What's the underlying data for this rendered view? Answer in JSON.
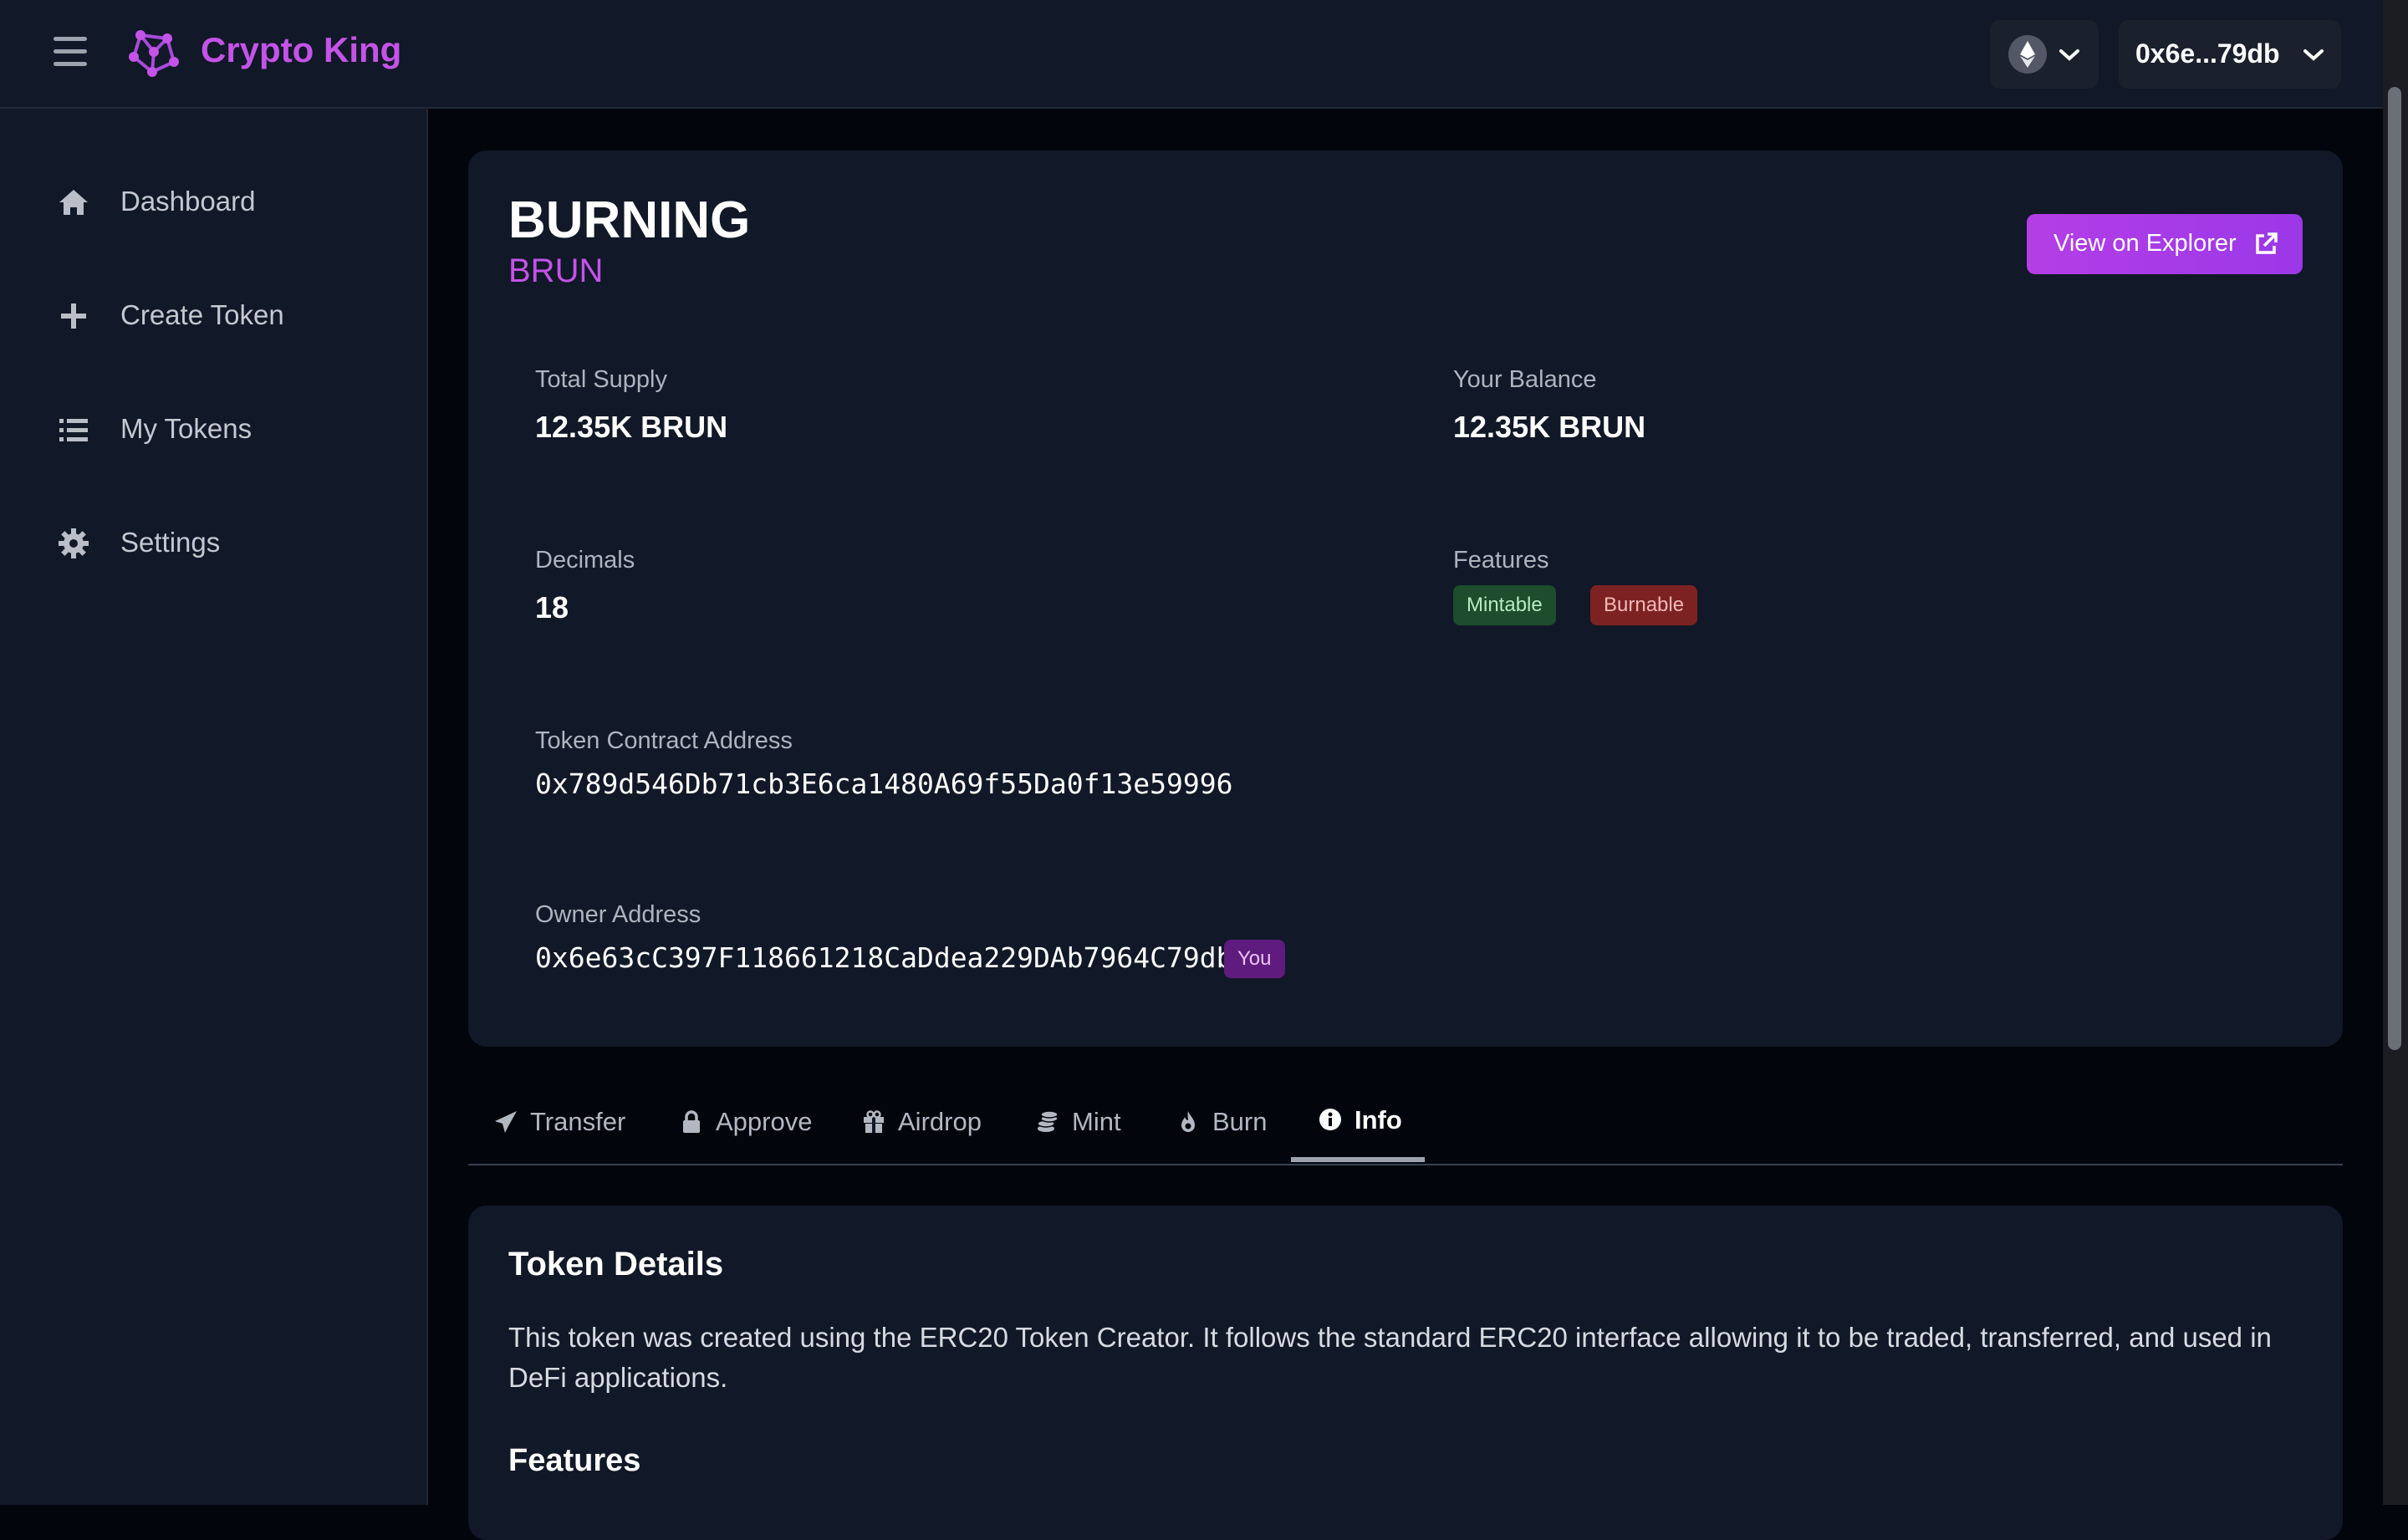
{
  "header": {
    "brand": "Crypto King",
    "wallet_address": "0x6e...79db",
    "icons": [
      "menu-icon",
      "network-logo",
      "ethereum-icon",
      "chevron-down-icon"
    ]
  },
  "sidebar": {
    "items": [
      {
        "label": "Dashboard",
        "icon": "home-icon"
      },
      {
        "label": "Create Token",
        "icon": "plus-icon"
      },
      {
        "label": "My Tokens",
        "icon": "list-icon"
      },
      {
        "label": "Settings",
        "icon": "gear-icon"
      }
    ]
  },
  "token": {
    "name": "BURNING",
    "symbol": "BRUN",
    "explorer_label": "View on Explorer",
    "total_supply_label": "Total Supply",
    "total_supply": "12.35K BRUN",
    "balance_label": "Your Balance",
    "balance": "12.35K BRUN",
    "decimals_label": "Decimals",
    "decimals": "18",
    "features_label": "Features",
    "features": [
      "Mintable",
      "Burnable"
    ],
    "contract_label": "Token Contract Address",
    "contract": "0x789d546Db71cb3E6ca1480A69f55Da0f13e59996",
    "owner_label": "Owner Address",
    "owner": "0x6e63cC397F118661218CaDdea229DAb7964C79db",
    "owner_badge": "You"
  },
  "tabs": [
    {
      "label": "Transfer",
      "icon": "paper-plane-icon"
    },
    {
      "label": "Approve",
      "icon": "lock-icon"
    },
    {
      "label": "Airdrop",
      "icon": "gift-icon"
    },
    {
      "label": "Mint",
      "icon": "coins-icon"
    },
    {
      "label": "Burn",
      "icon": "fire-icon"
    },
    {
      "label": "Info",
      "icon": "info-icon",
      "active": true
    }
  ],
  "details": {
    "title": "Token Details",
    "description": "This token was created using the ERC20 Token Creator. It follows the standard ERC20 interface allowing it to be traded, transferred, and used in DeFi applications.",
    "features_heading": "Features"
  },
  "colors": {
    "accent": "#c453e8",
    "background": "#03050d",
    "panel": "#111827",
    "mintable_badge": "#1d4d2c",
    "burnable_badge": "#7d2222",
    "you_badge": "#5f1b7d"
  }
}
